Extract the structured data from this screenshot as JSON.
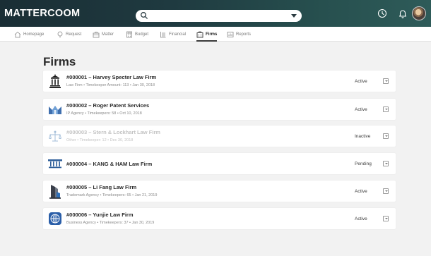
{
  "app": {
    "logo_text": "MATTERCOOM"
  },
  "search": {
    "placeholder": ""
  },
  "nav": {
    "items": [
      {
        "label": "Homepage",
        "icon": "home-icon"
      },
      {
        "label": "Request",
        "icon": "lightbulb-icon"
      },
      {
        "label": "Matter",
        "icon": "briefcase-icon"
      },
      {
        "label": "Budget",
        "icon": "calculator-icon"
      },
      {
        "label": "Financial",
        "icon": "ledger-icon"
      },
      {
        "label": "Firms",
        "icon": "building-icon",
        "active": true
      },
      {
        "label": "Reports",
        "icon": "report-icon"
      }
    ]
  },
  "page": {
    "title": "Firms"
  },
  "firms": [
    {
      "title": "#000001 – Harvey Specter Law Firm",
      "subtitle": "Law Firm • Timekeeper Amount: 113 • Jan 30, 2018",
      "status": "Active",
      "logo": "courthouse-icon"
    },
    {
      "title": "#000002 – Roger Patent Services",
      "subtitle": "IP Agency • Timekeepers: 58 • Oct 10, 2018",
      "status": "Active",
      "logo": "mountain-logo-icon"
    },
    {
      "title": "#000003 – Stern & Lockhart Law Firm",
      "subtitle": "Other • Timekeeper: 12 • Dec 30, 2018",
      "status": "Inactive",
      "logo": "scales-icon"
    },
    {
      "title": "#000004 – KANG & HAM Law Firm",
      "subtitle": "",
      "status": "Pending",
      "logo": "pillars-icon"
    },
    {
      "title": "#000005 – Li Fang Law Firm",
      "subtitle": "Trademark Agency • Timekeepers: 65 • Jan 21, 2019",
      "status": "Active",
      "logo": "tower-icon"
    },
    {
      "title": "#000006 – Yunjie Law Firm",
      "subtitle": "Business Agency • Timekeepers: 37 • Jan 30, 2019",
      "status": "Active",
      "logo": "globe-badge-icon"
    }
  ],
  "colors": {
    "topbar_start": "#1a2e35",
    "topbar_end": "#2e5b59",
    "background": "#f2f2f2",
    "accent_blue": "#3f6fae"
  }
}
